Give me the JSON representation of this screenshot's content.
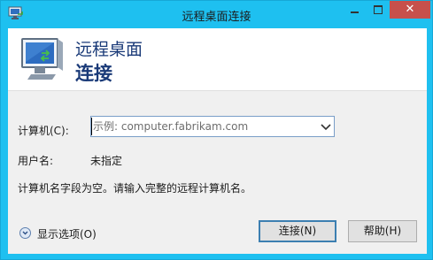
{
  "window": {
    "title": "远程桌面连接",
    "close_glyph": "✕"
  },
  "header": {
    "line1": "远程桌面",
    "line2": "连接"
  },
  "form": {
    "computer_label": "计算机(C):",
    "computer_placeholder": "示例: computer.fabrikam.com",
    "computer_value": "",
    "user_label": "用户名:",
    "user_value": "未指定",
    "hint": "计算机名字段为空。请输入完整的远程计算机名。"
  },
  "footer": {
    "show_options": "显示选项(O)",
    "connect": "连接(N)",
    "help": "帮助(H)"
  },
  "colors": {
    "frame": "#1ec0f0",
    "close_button": "#c7504b",
    "header_text": "#1a3a78",
    "default_button_border": "#3c7fb1"
  },
  "icons": [
    "remote-desktop-icon",
    "monitor-icon",
    "minimize-icon",
    "maximize-icon",
    "close-icon",
    "chevron-down-icon"
  ]
}
